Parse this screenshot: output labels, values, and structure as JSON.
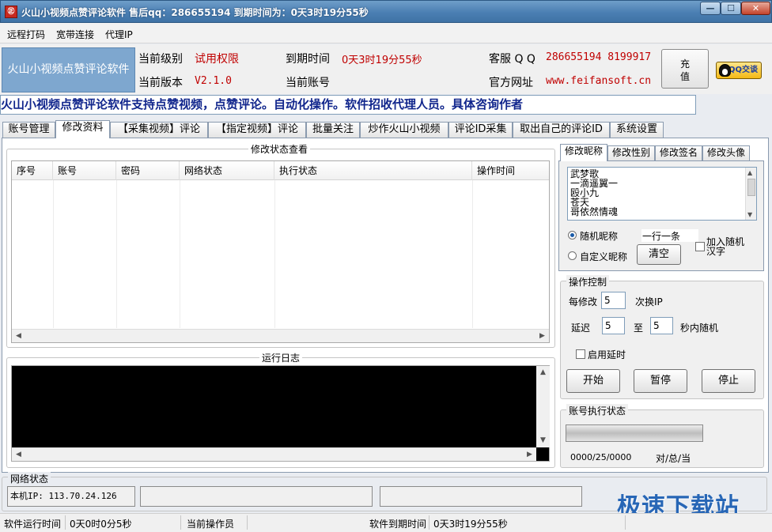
{
  "window": {
    "title": "火山小视频点赞评论软件 售后qq：286655194 到期时间为：0天3时19分55秒",
    "icon_glyph": "㊣",
    "controls": [
      "—",
      "☐",
      "✕"
    ]
  },
  "menu": [
    "远程打码",
    "宽带连接",
    "代理IP"
  ],
  "header": {
    "logo_text": "火山小视频点赞评论软件",
    "level_label": "当前级别",
    "level_value": "试用权限",
    "version_label": "当前版本",
    "version_value": "V2.1.0",
    "expire_label": "到期时间",
    "expire_value": "0天3时19分55秒",
    "account_label": "当前账号",
    "account_value": "",
    "service_label": "客服 Q Q",
    "service_value": "286655194 8199917",
    "website_label": "官方网址",
    "website_value": "www.feifansoft.cn",
    "recharge_label": "充值",
    "qq_badge": "QQ交谈"
  },
  "marquee": "火山小视频点赞评论软件支持点赞视频，点赞评论。自动化操作。软件招收代理人员。具体咨询作者",
  "tabs": [
    "账号管理",
    "修改资料",
    "【采集视频】评论",
    "【指定视频】评论",
    "批量关注",
    "炒作火山小视频",
    "评论ID采集",
    "取出自己的评论ID",
    "系统设置"
  ],
  "active_tab": "修改资料",
  "status_view": {
    "title": "修改状态查看",
    "columns": [
      "序号",
      "账号",
      "密码",
      "网络状态",
      "执行状态",
      "操作时间"
    ],
    "rows": []
  },
  "log": {
    "title": "运行日志",
    "lines": []
  },
  "subtabs": [
    "修改昵称",
    "修改性别",
    "修改签名",
    "修改头像"
  ],
  "nickname": {
    "list": [
      "武梦歌",
      "一滴遥翼一",
      "殴小九",
      "苍天",
      "哥依然情魂"
    ],
    "random_label": "随机昵称",
    "per_line_label": "一行一条",
    "add_random_label": "加入随机汉字",
    "custom_label": "自定义昵称",
    "clear_button": "清空"
  },
  "control": {
    "title": "操作控制",
    "every_label": "每修改",
    "every_value": "5",
    "switch_ip_label": "次换IP",
    "delay_label": "延迟",
    "delay_min": "5",
    "to_label": "至",
    "delay_max": "5",
    "random_label": "秒内随机",
    "enable_delay_label": "启用延时",
    "start_button": "开始",
    "pause_button": "暂停",
    "stop_button": "停止"
  },
  "exec_status": {
    "title": "账号执行状态",
    "counter": "0000/25/0000",
    "counter_desc": "对/总/当",
    "progress": 0
  },
  "network": {
    "title": "网络状态",
    "local_ip": "本机IP: 113.70.24.126",
    "box2": "",
    "box3": ""
  },
  "statusbar": {
    "runtime_label": "软件运行时间",
    "runtime_value": "0天0时0分5秒",
    "operator_label": "当前操作员",
    "operator_value": "",
    "expire_label": "软件到期时间",
    "expire_value": "0天3时19分55秒"
  },
  "watermark": "极速下载站",
  "colors": {
    "title_bar": "#4b7fb3",
    "highlight_red": "#c00000",
    "marquee_blue": "#10258c",
    "watermark_blue": "#2766b6"
  }
}
